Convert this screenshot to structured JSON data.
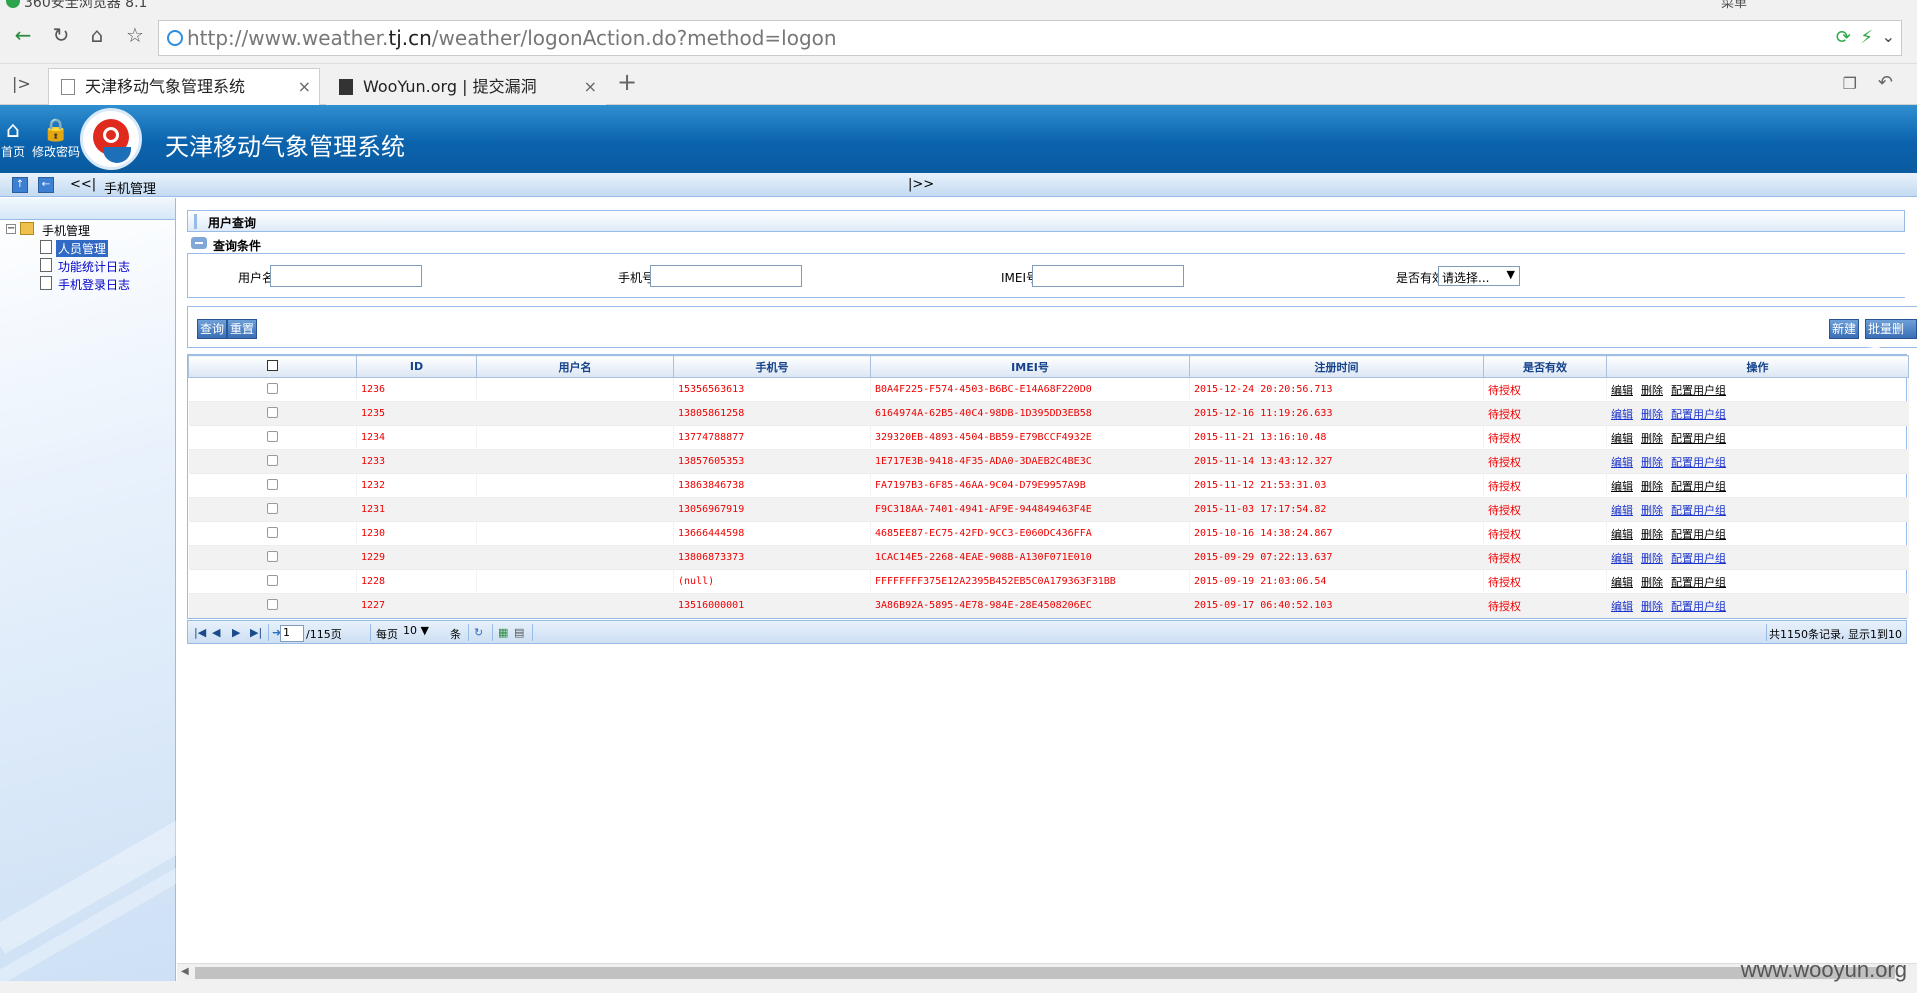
{
  "browser": {
    "window_title": "360安全浏览器 8.1",
    "window_right_label": "菜单",
    "url_prefix": "http://www.weather.",
    "url_domain": "tj.cn",
    "url_suffix": "/weather/logonAction.do?method=logon",
    "tabs": [
      {
        "label": "天津移动气象管理系统"
      },
      {
        "label": "WooYun.org | 提交漏洞"
      }
    ]
  },
  "header": {
    "home_label": "首页",
    "password_label": "修改密码",
    "title": "天津移动气象管理系统"
  },
  "crumb": {
    "nav_left": "<<|",
    "label": "手机管理",
    "nav_right": "|>>"
  },
  "sidebar": {
    "root": "手机管理",
    "items": [
      {
        "label": "人员管理"
      },
      {
        "label": "功能统计日志"
      },
      {
        "label": "手机登录日志"
      }
    ]
  },
  "query": {
    "panel_title": "用户查询",
    "section_title": "查询条件",
    "username_label": "用户名",
    "phone_label": "手机号",
    "imei_label": "IMEI号",
    "valid_label": "是否有效",
    "valid_value": "请选择...",
    "search_btn": "查询",
    "reset_btn": "重置",
    "new_btn": "新建",
    "batch_delete_btn": "批量删除"
  },
  "grid": {
    "columns": [
      "ID",
      "用户名",
      "手机号",
      "IMEI号",
      "注册时间",
      "是否有效",
      "操作"
    ],
    "op_labels": {
      "edit": "编辑",
      "delete": "删除",
      "group": "配置用户组"
    },
    "rows": [
      {
        "id": "1236",
        "username": "",
        "phone": "15356563613",
        "imei": "B0A4F225-F574-4503-B6BC-E14A68F220D0",
        "time": "2015-12-24 20:20:56.713",
        "valid": "待授权"
      },
      {
        "id": "1235",
        "username": "",
        "phone": "13805861258",
        "imei": "6164974A-62B5-40C4-98DB-1D395DD3EB58",
        "time": "2015-12-16 11:19:26.633",
        "valid": "待授权"
      },
      {
        "id": "1234",
        "username": "",
        "phone": "13774788877",
        "imei": "329320EB-4893-4504-BB59-E79BCCF4932E",
        "time": "2015-11-21 13:16:10.48",
        "valid": "待授权"
      },
      {
        "id": "1233",
        "username": "",
        "phone": "13857605353",
        "imei": "1E717E3B-9418-4F35-ADA0-3DAEB2C4BE3C",
        "time": "2015-11-14 13:43:12.327",
        "valid": "待授权"
      },
      {
        "id": "1232",
        "username": "",
        "phone": "13863846738",
        "imei": "FA7197B3-6F85-46AA-9C04-D79E9957A9B",
        "time": "2015-11-12 21:53:31.03",
        "valid": "待授权"
      },
      {
        "id": "1231",
        "username": "",
        "phone": "13056967919",
        "imei": "F9C318AA-7401-4941-AF9E-944849463F4E",
        "time": "2015-11-03 17:17:54.82",
        "valid": "待授权"
      },
      {
        "id": "1230",
        "username": "",
        "phone": "13666444598",
        "imei": "4685EE87-EC75-42FD-9CC3-E060DC436FFA",
        "time": "2015-10-16 14:38:24.867",
        "valid": "待授权"
      },
      {
        "id": "1229",
        "username": "",
        "phone": "13806873373",
        "imei": "1CAC14E5-2268-4EAE-908B-A130F071E010",
        "time": "2015-09-29 07:22:13.637",
        "valid": "待授权"
      },
      {
        "id": "1228",
        "username": "",
        "phone": "(null)",
        "imei": "FFFFFFFF375E12A2395B452EB5C0A179363F31BB",
        "time": "2015-09-19 21:03:06.54",
        "valid": "待授权"
      },
      {
        "id": "1227",
        "username": "",
        "phone": "13516000001",
        "imei": "3A86B92A-5895-4E78-984E-28E4508206EC",
        "time": "2015-09-17 06:40:52.103",
        "valid": "待授权"
      }
    ]
  },
  "pager": {
    "page": "1",
    "total_pages": "/115页",
    "per_page_label": "每页",
    "per_page_value": "10",
    "unit": "条",
    "summary": "共1150条记录, 显示1到10"
  },
  "watermark": "www.wooyun.org"
}
